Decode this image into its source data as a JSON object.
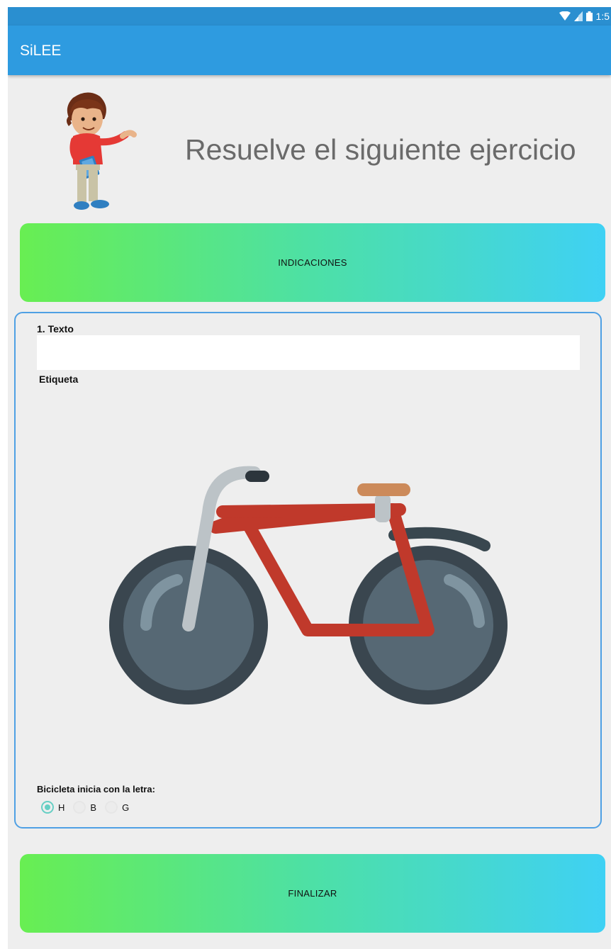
{
  "status": {
    "time": "1:5",
    "icons": [
      "wifi-icon",
      "signal-icon",
      "battery-icon"
    ]
  },
  "app": {
    "title": "SiLEE"
  },
  "header": {
    "heading": "Resuelve el siguiente ejercicio"
  },
  "buttons": {
    "indicaciones": "INDICACIONES",
    "finalizar": "FINALIZAR"
  },
  "exercise": {
    "text_label": "1. Texto",
    "text_value": "",
    "tag_label": "Etiqueta",
    "image": "bicycle-illustration",
    "question": "Bicicleta inicia con la letra:",
    "options": [
      {
        "label": "H",
        "checked": true
      },
      {
        "label": "B",
        "checked": false
      },
      {
        "label": "G",
        "checked": false
      }
    ]
  },
  "colors": {
    "app_bar": "#2e9be0",
    "status_bar": "#2a8fd0",
    "gradient_start": "#68ee52",
    "gradient_end": "#3fd1f4",
    "card_border": "#4fa0e4",
    "radio_selected": "#66cfc4"
  }
}
